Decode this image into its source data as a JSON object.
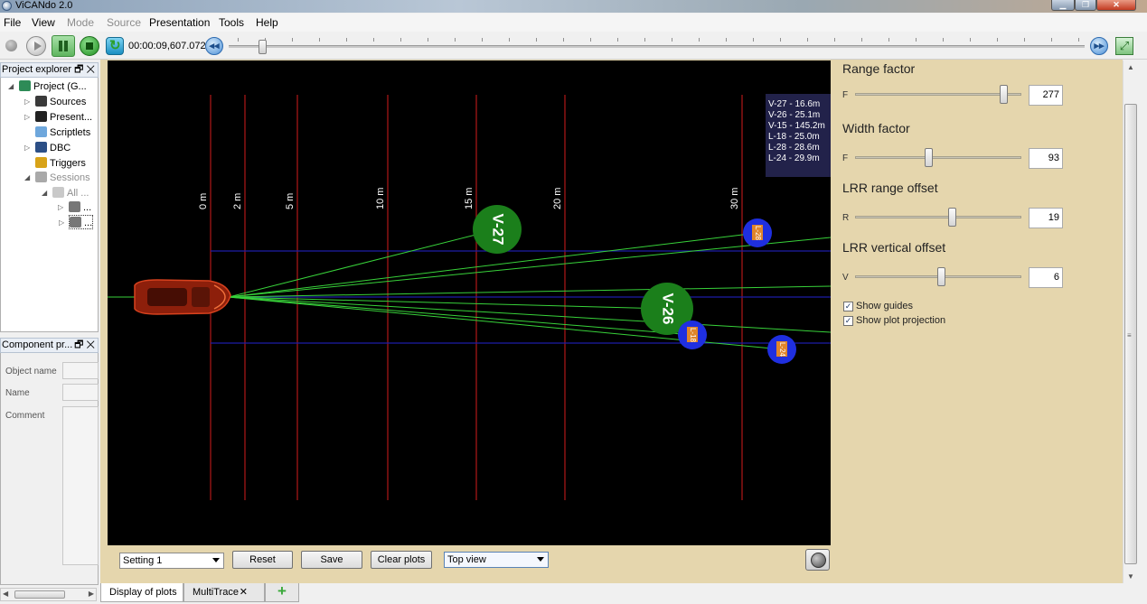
{
  "window": {
    "title": "ViCANdo 2.0"
  },
  "menu": {
    "file": "File",
    "view": "View",
    "mode": "Mode",
    "source": "Source",
    "presentation": "Presentation",
    "tools": "Tools",
    "help": "Help"
  },
  "toolbar": {
    "time": "00:00:09,607.072"
  },
  "project_explorer": {
    "title": "Project explorer",
    "items": [
      {
        "label": "Project (G...",
        "icon": "project-icon"
      },
      {
        "label": "Sources",
        "icon": "sources-icon"
      },
      {
        "label": "Present...",
        "icon": "presentation-icon"
      },
      {
        "label": "Scriptlets",
        "icon": "script-icon"
      },
      {
        "label": "DBC",
        "icon": "dbc-icon"
      },
      {
        "label": "Triggers",
        "icon": "trigger-icon"
      },
      {
        "label": "Sessions",
        "icon": "sessions-icon"
      },
      {
        "label": "All ...",
        "icon": "folder-icon"
      },
      {
        "label": "...",
        "icon": "disk-icon"
      },
      {
        "label": "...",
        "icon": "disk-icon"
      }
    ]
  },
  "component_props": {
    "title": "Component pr...",
    "object_name": "Object name",
    "name": "Name",
    "comment": "Comment"
  },
  "plot": {
    "range_labels": [
      "0 m",
      "2 m",
      "5 m",
      "10 m",
      "15 m",
      "20 m",
      "30 m"
    ],
    "legend": [
      "V-27 - 16.6m",
      "V-26 - 25.1m",
      "V-15 - 145.2m",
      "L-18 - 25.0m",
      "L-28 - 28.6m",
      "L-24 - 29.9m"
    ],
    "targets": [
      {
        "label": "V-27",
        "kind": "vision"
      },
      {
        "label": "V-26",
        "kind": "vision"
      },
      {
        "label": "L-18",
        "kind": "lidar"
      },
      {
        "label": "L-28",
        "kind": "lidar"
      },
      {
        "label": "L-24",
        "kind": "lidar"
      }
    ]
  },
  "bottom_bar": {
    "setting": "Setting 1",
    "reset": "Reset",
    "save": "Save",
    "clear": "Clear plots",
    "view": "Top view"
  },
  "settings": {
    "range_factor": {
      "title": "Range factor",
      "letter": "F",
      "value": "277"
    },
    "width_factor": {
      "title": "Width factor",
      "letter": "F",
      "value": "93"
    },
    "lrr_range": {
      "title": "LRR range offset",
      "letter": "R",
      "value": "19"
    },
    "lrr_vertical": {
      "title": "LRR vertical offset",
      "letter": "V",
      "value": "6"
    },
    "show_guides": "Show guides",
    "show_projection": "Show plot projection"
  },
  "tabs": {
    "display": "Display of plots",
    "multitrace": "MultiTrace"
  },
  "colors": {
    "panel": "#e5d6ad",
    "range_line": "#a31515",
    "lane_line": "#1e1ea8",
    "beam": "#38d23a",
    "vision_target": "#1b7f1b",
    "lidar_target": "#1f2fe0",
    "car": "#b52a10"
  }
}
